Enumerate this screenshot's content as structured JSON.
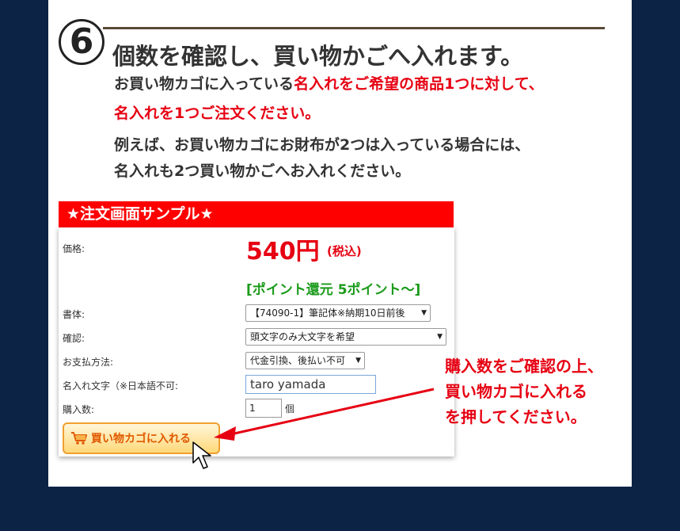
{
  "step": {
    "number": "6",
    "heading": "個数を確認し、買い物かごへ入れます。"
  },
  "instructions": {
    "line1_plain": "お買い物カゴに入っている",
    "line1_red": "名入れをご希望の商品1つに対して、",
    "line2_red": "名入れを1つご注文ください。",
    "line3": "例えば、お買い物カゴにお財布が2つは入っている場合には、",
    "line4": "名入れも2つ買い物かごへお入れください。"
  },
  "sample": {
    "title": "★注文画面サンプル★",
    "price_label": "価格:",
    "price": "540円",
    "tax": "(税込)",
    "points": "[ポイント還元 5ポイント〜]",
    "font_label": "書体:",
    "font_value": "【74090-1】筆記体※納期10日前後",
    "confirm_label": "確認:",
    "confirm_value": "頭文字のみ大文字を希望",
    "payment_label": "お支払方法:",
    "payment_value": "代金引換、後払い不可",
    "name_label": "名入れ文字（※日本語不可:",
    "name_value": "taro yamada",
    "qty_label": "購入数:",
    "qty_value": "1",
    "qty_unit": "個",
    "cart_button": "買い物カゴに入れる"
  },
  "note": {
    "line1": "購入数をご確認の上、",
    "line2": "買い物カゴに入れる",
    "line3": "を押してください。"
  },
  "colors": {
    "background": "#0c2346",
    "accent_red": "#e60012",
    "points_green": "#1a9a1a",
    "button_orange": "#f0a030"
  }
}
